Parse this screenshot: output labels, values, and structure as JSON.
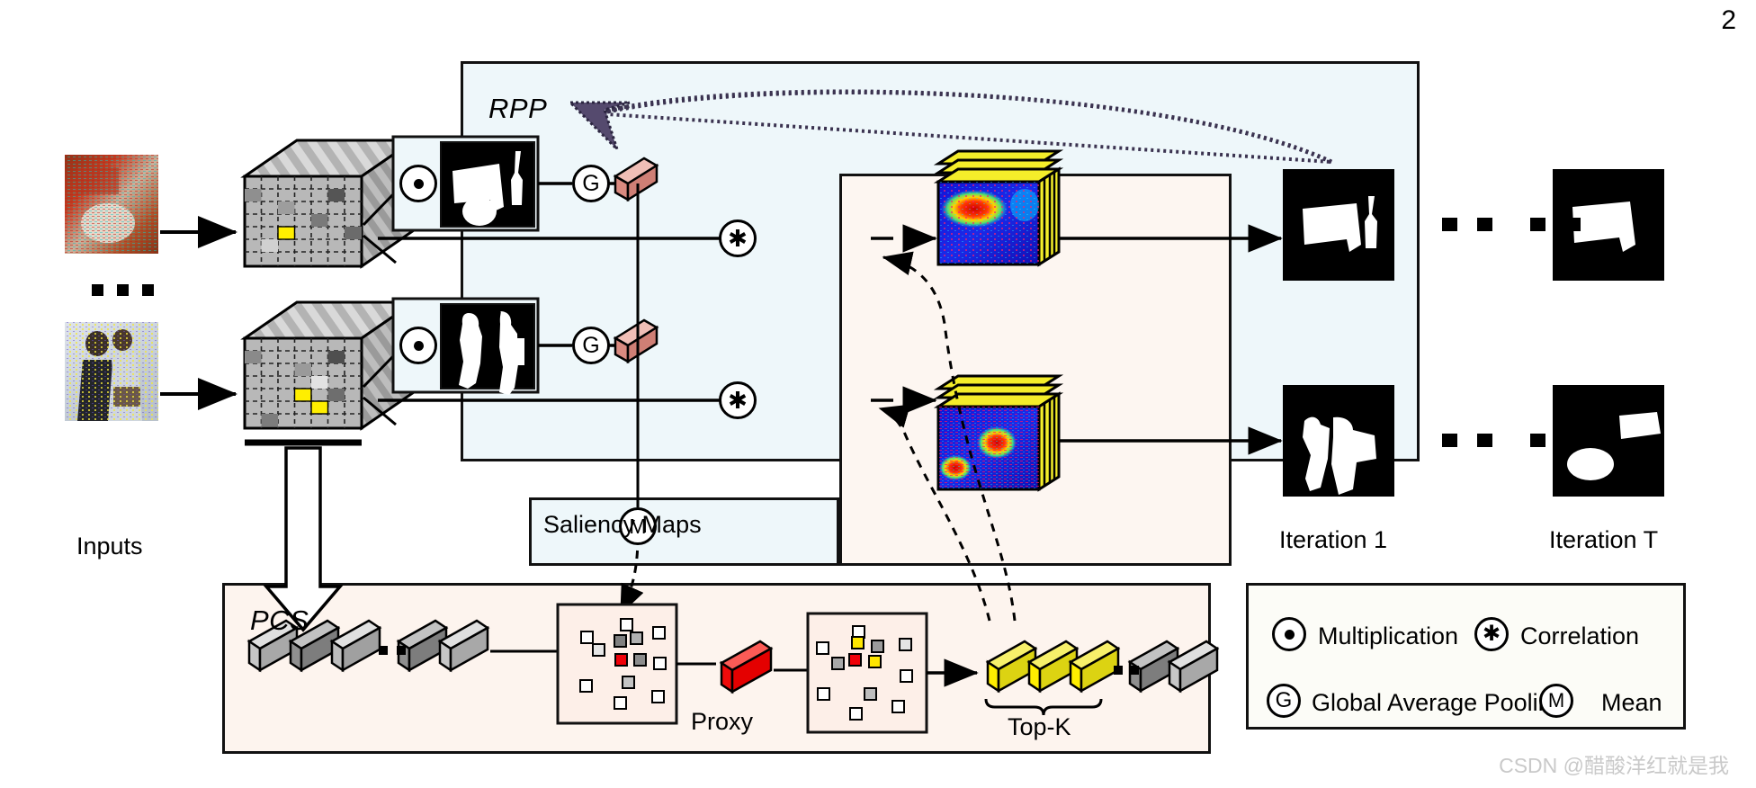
{
  "page": {
    "number": "2"
  },
  "watermark": {
    "text": "CSDN @醋酸洋红就是我"
  },
  "panels": {
    "rpp": {
      "label": "RPP"
    },
    "pcs": {
      "label": "PCS"
    },
    "saliency": {
      "label": "Saliency Maps"
    }
  },
  "labels": {
    "inputs": "Inputs",
    "proxy": "Proxy",
    "topk": "Top-K",
    "iteration_1": "Iteration 1",
    "iteration_t": "Iteration T"
  },
  "operators": {
    "multiplication_glyph": "⊙",
    "correlation_glyph": "✱",
    "gap_glyph": "G",
    "mean_glyph": "M"
  },
  "legend": {
    "items": [
      {
        "glyph": "⊙",
        "icon": "multiplication-icon",
        "label": "Multiplication"
      },
      {
        "glyph": "✱",
        "icon": "correlation-icon",
        "label": "Correlation"
      },
      {
        "glyph": "G",
        "icon": "global-average-pooling-icon",
        "label": "Global Average Pooling"
      },
      {
        "glyph": "M",
        "icon": "mean-icon",
        "label": "Mean"
      }
    ]
  },
  "colors": {
    "rpp_panel_bg": "#eef7fa",
    "pcs_panel_bg": "#fdf4ee",
    "pink_panel_bg": "#fdf6f1",
    "legend_panel_bg": "#fcfcf7",
    "rpp_arrow": "#554a6e",
    "proxy_red": "#ef1d1d",
    "topk_yellow": "#f5ec1c",
    "feature_highlight_yellow": "#ffee00",
    "gap_vector_pink": "#e8a59c",
    "outline": "#111111",
    "watermark_gray": "#c9c9c9"
  },
  "flow": {
    "inputs_count_indicator": "...",
    "iterations_gap_indicator": "... ..."
  }
}
